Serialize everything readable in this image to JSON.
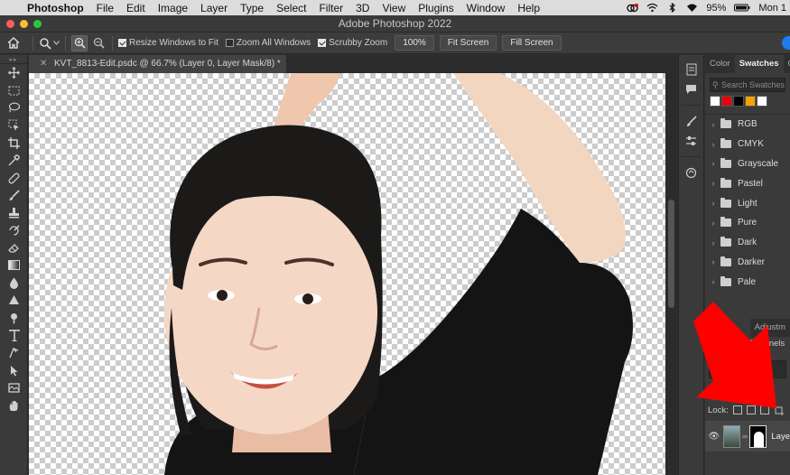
{
  "menubar": {
    "app_name": "Photoshop",
    "items": [
      "File",
      "Edit",
      "Image",
      "Layer",
      "Type",
      "Select",
      "Filter",
      "3D",
      "View",
      "Plugins",
      "Window",
      "Help"
    ],
    "battery": "95%",
    "clock": "Mon 1",
    "status_icons": [
      "creative-cloud-icon",
      "wifi-extra-icon",
      "bluetooth-icon",
      "wifi-icon",
      "battery-icon"
    ]
  },
  "window": {
    "title": "Adobe Photoshop 2022"
  },
  "options_bar": {
    "resize_windows_label": "Resize Windows to Fit",
    "resize_windows_checked": true,
    "zoom_all_label": "Zoom All Windows",
    "zoom_all_checked": false,
    "scrubby_zoom_label": "Scrubby Zoom",
    "scrubby_zoom_checked": true,
    "zoom_100_label": "100%",
    "fit_screen_label": "Fit Screen",
    "fill_screen_label": "Fill Screen"
  },
  "document": {
    "tab_title": "KVT_8813-Edit.psdc @ 66.7% (Layer 0, Layer Mask/8) *"
  },
  "toolbox": {
    "tools": [
      "move-tool-icon",
      "marquee-tool-icon",
      "lasso-tool-icon",
      "object-select-tool-icon",
      "crop-tool-icon",
      "eyedropper-tool-icon",
      "healing-brush-tool-icon",
      "brush-tool-icon",
      "clone-stamp-tool-icon",
      "history-brush-tool-icon",
      "eraser-tool-icon",
      "gradient-tool-icon",
      "blur-tool-icon",
      "dodge-tool-icon",
      "pen-tool-icon",
      "type-tool-icon",
      "path-select-tool-icon",
      "shape-tool-icon",
      "hand-tool-icon",
      "zoom-tool-icon"
    ]
  },
  "swatches_panel": {
    "tabs": [
      "Color",
      "Swatches",
      "Gr"
    ],
    "active_tab": "Swatches",
    "search_placeholder": "Search Swatches",
    "recent_colors": [
      "#ffffff",
      "#e8000b",
      "#000000",
      "#f5a300",
      "#ffffff"
    ],
    "groups": [
      "RGB",
      "CMYK",
      "Grayscale",
      "Pastel",
      "Light",
      "Pure",
      "Dark",
      "Darker",
      "Pale"
    ]
  },
  "layers_panel": {
    "tabs": [
      "",
      "Adjustm"
    ],
    "channels_tab": "Channels",
    "lock_label": "Lock:",
    "layer_name": "Laye"
  },
  "colors": {
    "annotation_arrow": "#ff0000",
    "accent": "#1e7bf2"
  }
}
